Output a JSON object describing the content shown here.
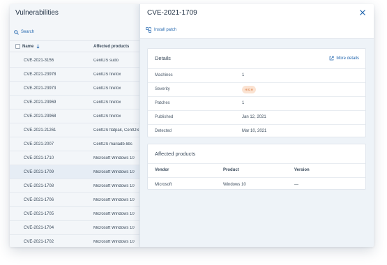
{
  "list": {
    "title": "Vulnerabilities",
    "search_label": "Search",
    "columns": {
      "name": "Name",
      "affected": "Affected products"
    },
    "rows": [
      {
        "cve": "CVE-2021-3156",
        "product": "CentOS sudo"
      },
      {
        "cve": "CVE-2021-23978",
        "product": "CentOS firefox"
      },
      {
        "cve": "CVE-2021-23973",
        "product": "CentOS firefox"
      },
      {
        "cve": "CVE-2021-23969",
        "product": "CentOS firefox"
      },
      {
        "cve": "CVE-2021-23968",
        "product": "CentOS firefox"
      },
      {
        "cve": "CVE-2021-21261",
        "product": "CentOS flatpak, CentOS"
      },
      {
        "cve": "CVE-2021-2007",
        "product": "CentOS mariadb-libs"
      },
      {
        "cve": "CVE-2021-1710",
        "product": "Microsoft Windows 10"
      },
      {
        "cve": "CVE-2021-1709",
        "product": "Microsoft Windows 10"
      },
      {
        "cve": "CVE-2021-1708",
        "product": "Microsoft Windows 10"
      },
      {
        "cve": "CVE-2021-1706",
        "product": "Microsoft Windows 10"
      },
      {
        "cve": "CVE-2021-1705",
        "product": "Microsoft Windows 10"
      },
      {
        "cve": "CVE-2021-1704",
        "product": "Microsoft Windows 10"
      },
      {
        "cve": "CVE-2021-1702",
        "product": "Microsoft Windows 10"
      }
    ],
    "selected_cve": "CVE-2021-1709"
  },
  "detail": {
    "title": "CVE-2021-1709",
    "install_label": "Install patch",
    "details_card": {
      "title": "Details",
      "more_label": "More details",
      "fields": [
        {
          "label": "Machines",
          "value": "1"
        },
        {
          "label": "Severity",
          "value": "HIGH"
        },
        {
          "label": "Patches",
          "value": "1"
        },
        {
          "label": "Published",
          "value": "Jan 12, 2021"
        },
        {
          "label": "Detected",
          "value": "Mar 10, 2021"
        }
      ]
    },
    "affected_card": {
      "title": "Affected products",
      "columns": {
        "vendor": "Vendor",
        "product": "Product",
        "version": "Version"
      },
      "row": {
        "vendor": "Microsoft",
        "product": "Windows 10",
        "version": "—"
      }
    }
  },
  "colors": {
    "accent": "#2669b0",
    "severity_bg": "#fbe3d2",
    "severity_fg": "#d9753a",
    "selected_row": "#e6edf5"
  },
  "icons": {
    "search": "search-icon",
    "sort": "sort-down-arrow-icon",
    "close": "close-icon",
    "install": "install-patch-icon",
    "more": "external-link-icon"
  }
}
